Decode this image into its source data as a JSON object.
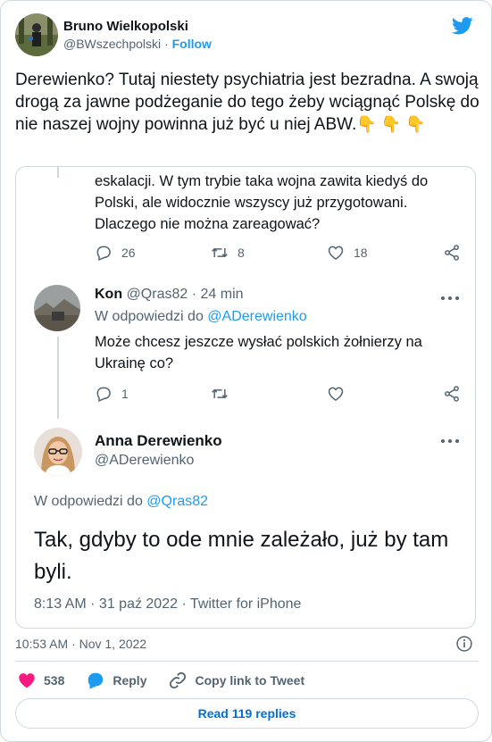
{
  "author": {
    "name": "Bruno Wielkopolski",
    "handle": "@BWszechpolski",
    "separator": " · ",
    "follow_label": "Follow"
  },
  "tweet": {
    "text": "Derewienko? Tutaj niestety psychiatria jest bezradna. A swoją drogą za jawne podżeganie do tego żeby wciągnąć Polskę do nie naszej wojny powinna już być u niej ABW.",
    "emoji": "👇 👇 👇"
  },
  "quote": {
    "top_post": {
      "text": "eskalacji. W tym trybie taka wojna zawita kiedyś do Polski, ale widocznie wszyscy już przygotowani. Dlaczego nie można zareagować?",
      "reply_count": "26",
      "retweet_count": "8",
      "like_count": "18"
    },
    "reply": {
      "name": "Kon",
      "handle": "@Qras82",
      "time": "· 24 min",
      "in_reply_prefix": "W odpowiedzi do ",
      "in_reply_handle": "@ADerewienko",
      "text": "Może chcesz jeszcze wysłać polskich żołnierzy na Ukrainę co?",
      "reply_count": "1"
    },
    "main_post": {
      "name": "Anna Derewienko",
      "handle": "@ADerewienko",
      "in_reply_prefix": "W odpowiedzi do ",
      "in_reply_handle": "@Qras82",
      "text": "Tak, gdyby to ode mnie zależało, już by tam byli.",
      "timestamp": "8:13 AM · 31 paź 2022 · Twitter for iPhone"
    }
  },
  "footer": {
    "timestamp": "10:53 AM · Nov 1, 2022",
    "like_count": "538",
    "reply_label": "Reply",
    "copy_label": "Copy link to Tweet",
    "read_replies_label": "Read 119 replies"
  },
  "colors": {
    "accent": "#1d9bf0",
    "like": "#f91880",
    "text": "#0f1419",
    "muted": "#536471",
    "border": "#cfd9de"
  }
}
